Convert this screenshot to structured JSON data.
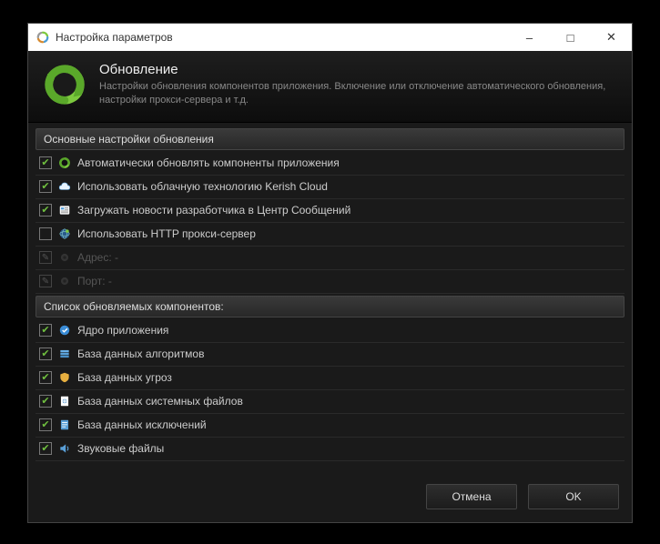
{
  "titlebar": {
    "title": "Настройка параметров"
  },
  "header": {
    "title": "Обновление",
    "subtitle": "Настройки обновления компонентов приложения. Включение или отключение автоматического обновления, настройки прокси-сервера и т.д."
  },
  "section1": {
    "title": "Основные настройки обновления",
    "opt_auto_update": "Автоматически обновлять компоненты приложения",
    "opt_cloud": "Использовать облачную технологию Kerish Cloud",
    "opt_news": "Загружать новости разработчика в Центр Сообщений",
    "opt_proxy": "Использовать HTTP прокси-сервер",
    "proxy_address_label": "Адрес: -",
    "proxy_port_label": "Порт: -"
  },
  "section2": {
    "title": "Список обновляемых компонентов:",
    "comp_core": "Ядро приложения",
    "comp_algo": "База данных алгоритмов",
    "comp_threats": "База данных угроз",
    "comp_sysfiles": "База данных системных файлов",
    "comp_exclusions": "База данных исключений",
    "comp_sounds": "Звуковые файлы"
  },
  "footer": {
    "cancel": "Отмена",
    "ok": "OK"
  },
  "checkbox_states": {
    "auto_update": true,
    "cloud": true,
    "news": true,
    "proxy": false,
    "core": true,
    "algo": true,
    "threats": true,
    "sysfiles": true,
    "exclusions": true,
    "sounds": true
  }
}
